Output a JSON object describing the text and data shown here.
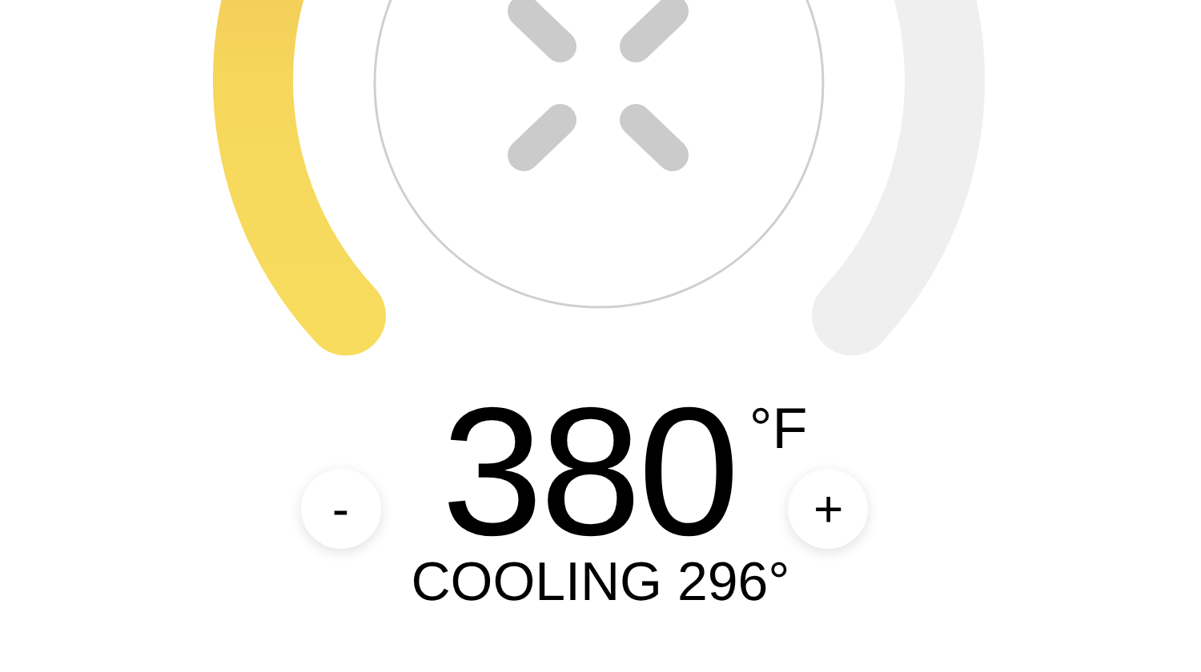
{
  "temperature": {
    "value": "380",
    "unit": "°F"
  },
  "buttons": [
    {
      "kind": "decrease",
      "label": "-"
    },
    {
      "kind": "increase",
      "label": "+"
    }
  ],
  "status": "COOLING 296°"
}
